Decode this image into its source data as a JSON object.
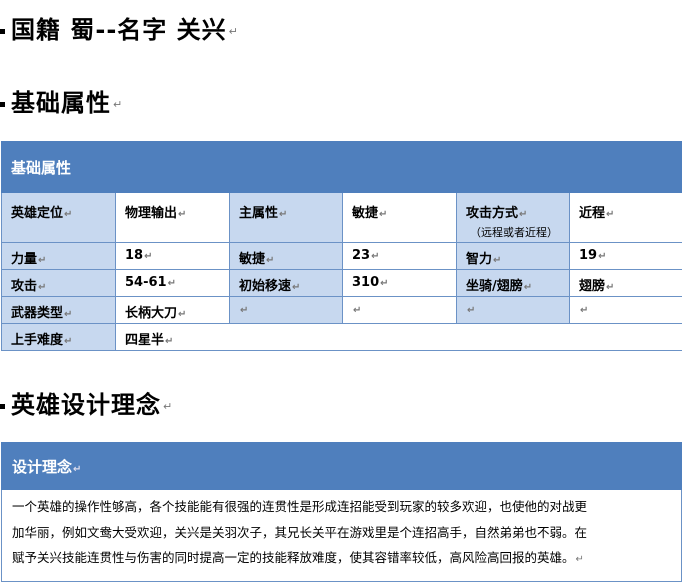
{
  "headings": {
    "nation": "国籍  蜀--名字  关兴",
    "basic": "基础属性",
    "design": "英雄设计理念"
  },
  "marks": {
    "pilcrow": "↵"
  },
  "attr_table": {
    "title": "基础属性",
    "row1": {
      "c1": "英雄定位",
      "c2": "物理输出",
      "c3": "主属性",
      "c4": "敏捷",
      "c5": "攻击方式",
      "c5_sub": "（远程或者近程）",
      "c6": "近程"
    },
    "row2": {
      "c1": "力量",
      "c2": "18",
      "c3": "敏捷",
      "c4": "23",
      "c5": "智力",
      "c6": "19"
    },
    "row3": {
      "c1": "攻击",
      "c2": "54-61",
      "c3": "初始移速",
      "c4": "310",
      "c5": "坐骑/翅膀",
      "c6": "翅膀"
    },
    "row4": {
      "c1": "武器类型",
      "c2": "长柄大刀"
    },
    "row5": {
      "c1": "上手难度",
      "c2": "四星半"
    }
  },
  "design_table": {
    "title": "设计理念",
    "line1": "一个英雄的操作性够高，各个技能能有很强的连贯性是形成连招能受到玩家的较多欢迎，也使他的对战更",
    "line2": "加华丽，例如文鸯大受欢迎，关兴是关羽次子，其兄长关平在游戏里是个连招高手，自然弟弟也不弱。在",
    "line3": "赋予关兴技能连贯性与伤害的同时提高一定的技能释放难度，使其容错率较低，高风险高回报的英雄。"
  },
  "colors": {
    "header_blue": "#4f7fbd",
    "label_blue": "#c7d8ef",
    "border_blue": "#6b92c6"
  }
}
